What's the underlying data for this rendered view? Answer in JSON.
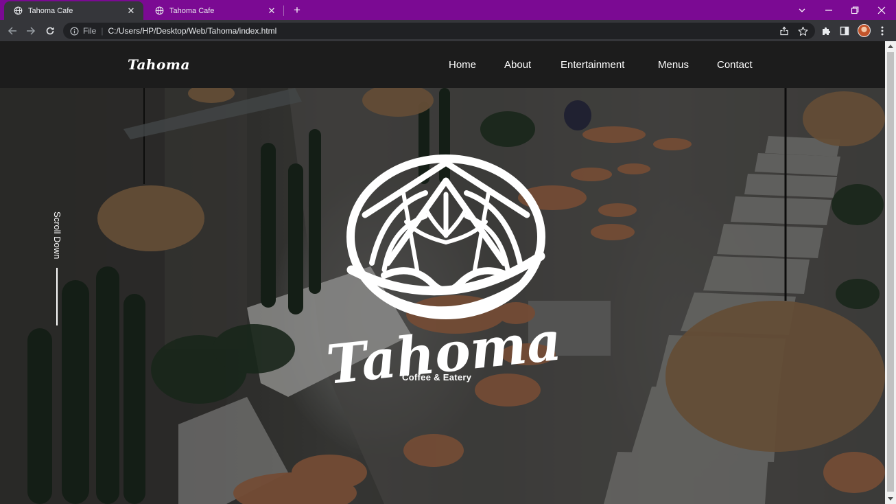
{
  "browser": {
    "tabs": [
      {
        "title": "Tahoma Cafe",
        "active": true
      },
      {
        "title": "Tahoma Cafe",
        "active": false
      }
    ],
    "address": {
      "scheme_label": "File",
      "url": "C:/Users/HP/Desktop/Web/Tahoma/index.html"
    },
    "colors": {
      "tabstrip": "#7b0a93",
      "toolbar": "#35363a"
    }
  },
  "site": {
    "brand": "Tahoma",
    "nav": [
      "Home",
      "About",
      "Entertainment",
      "Menus",
      "Contact"
    ],
    "hero": {
      "scroll_label": "Scroll Down",
      "logo_text": "Tahoma",
      "tagline": "Coffee & Eatery"
    }
  }
}
